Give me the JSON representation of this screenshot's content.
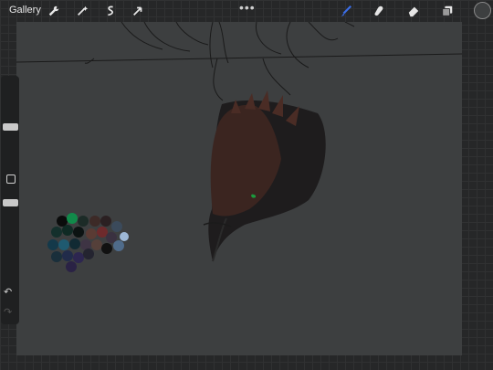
{
  "app": {
    "gallery_label": "Gallery",
    "more_label": "•••",
    "accent_color": "#3b6ee8"
  },
  "toolbar_left": {
    "actions_icon": "wrench-icon",
    "adjustments_icon": "magic-wand-icon",
    "selection_icon": "selection-s-icon",
    "transform_icon": "arrow-cursor-icon"
  },
  "toolbar_right": {
    "brush_icon": "brush-icon",
    "smudge_icon": "smudge-icon",
    "eraser_icon": "eraser-icon",
    "layers_icon": "layers-icon",
    "color_swatch": "#3d3f40"
  },
  "sidebar": {
    "undo_symbol": "↶",
    "redo_symbol": "↷"
  }
}
